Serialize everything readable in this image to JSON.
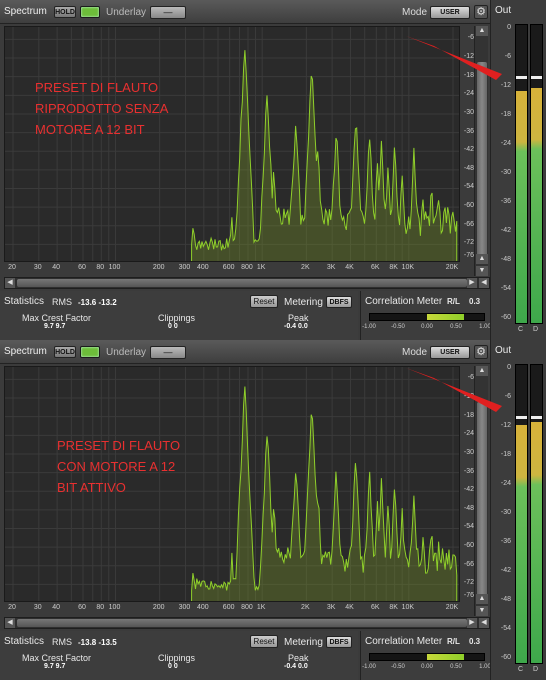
{
  "panels": [
    {
      "header": {
        "title": "Spectrum",
        "hold": "HOLD",
        "underlay": "Underlay",
        "underlay_btn": "—",
        "mode_label": "Mode",
        "mode_btn": "USER",
        "gear": "⚙"
      },
      "note_lines": [
        "PRESET DI FLAUTO",
        "RIPRODOTTO SENZA",
        "MOTORE A 12 BIT"
      ],
      "db_ticks": [
        "-6",
        "-12",
        "-18",
        "-24",
        "-30",
        "-36",
        "-42",
        "-48",
        "-54",
        "-60",
        "-66",
        "-72",
        "-76"
      ],
      "freq_ticks": [
        "20",
        "30",
        "40",
        "60",
        "80",
        "100",
        "200",
        "300",
        "400",
        "600",
        "800",
        "1K",
        "2K",
        "3K",
        "4K",
        "6K",
        "8K",
        "10K",
        "20K"
      ],
      "stats": {
        "title": "Statistics",
        "rms_label": "RMS",
        "rms_values": "-13.6  -13.2",
        "reset": "Reset",
        "metering": "Metering",
        "dbfs": "DBFS",
        "crest_label": "Max Crest Factor",
        "crest_values": "9.7   9.7",
        "clip_label": "Clippings",
        "clip_values": "0   0",
        "peak_label": "Peak",
        "peak_values": "-0.4   0.0"
      },
      "correlation": {
        "title": "Correlation Meter",
        "rl": "R/L",
        "value": "0.3",
        "ticks": [
          "-1.00",
          "-0.50",
          "0.00",
          "0.50",
          "1.00"
        ],
        "fill_from": 0.0,
        "fill_to": 0.65
      },
      "out": {
        "title": "Out",
        "scale": [
          "0",
          "-6",
          "-12",
          "-18",
          "-24",
          "-30",
          "-36",
          "-42",
          "-48",
          "-54",
          "-60"
        ],
        "left_level": 0.78,
        "right_level": 0.79,
        "left_peak": 0.82,
        "right_peak": 0.82,
        "ch_l": "C",
        "ch_r": "D"
      }
    },
    {
      "header": {
        "title": "Spectrum",
        "hold": "HOLD",
        "underlay": "Underlay",
        "underlay_btn": "—",
        "mode_label": "Mode",
        "mode_btn": "USER",
        "gear": "⚙"
      },
      "note_lines": [
        "PRESET DI FLAUTO",
        "CON MOTORE A 12",
        "BIT ATTIVO"
      ],
      "db_ticks": [
        "-6",
        "-12",
        "-18",
        "-24",
        "-30",
        "-36",
        "-42",
        "-48",
        "-54",
        "-60",
        "-66",
        "-72",
        "-76"
      ],
      "freq_ticks": [
        "20",
        "30",
        "40",
        "60",
        "80",
        "100",
        "200",
        "300",
        "400",
        "600",
        "800",
        "1K",
        "2K",
        "3K",
        "4K",
        "6K",
        "8K",
        "10K",
        "20K"
      ],
      "stats": {
        "title": "Statistics",
        "rms_label": "RMS",
        "rms_values": "-13.8  -13.5",
        "reset": "Reset",
        "metering": "Metering",
        "dbfs": "DBFS",
        "crest_label": "Max Crest Factor",
        "crest_values": "9.7   9.7",
        "clip_label": "Clippings",
        "clip_values": "0   0",
        "peak_label": "Peak",
        "peak_values": "-0.4   0.0"
      },
      "correlation": {
        "title": "Correlation Meter",
        "rl": "R/L",
        "value": "0.3",
        "ticks": [
          "-1.00",
          "-0.50",
          "0.00",
          "0.50",
          "1.00"
        ],
        "fill_from": 0.0,
        "fill_to": 0.65
      },
      "out": {
        "title": "Out",
        "scale": [
          "0",
          "-6",
          "-12",
          "-18",
          "-24",
          "-30",
          "-36",
          "-42",
          "-48",
          "-54",
          "-60"
        ],
        "left_level": 0.8,
        "right_level": 0.81,
        "left_peak": 0.82,
        "right_peak": 0.82,
        "ch_l": "C",
        "ch_r": "D"
      }
    }
  ],
  "colors": {
    "spectrum": "#8fcf2a",
    "note": "#e83030",
    "arrow": "#e02020"
  }
}
